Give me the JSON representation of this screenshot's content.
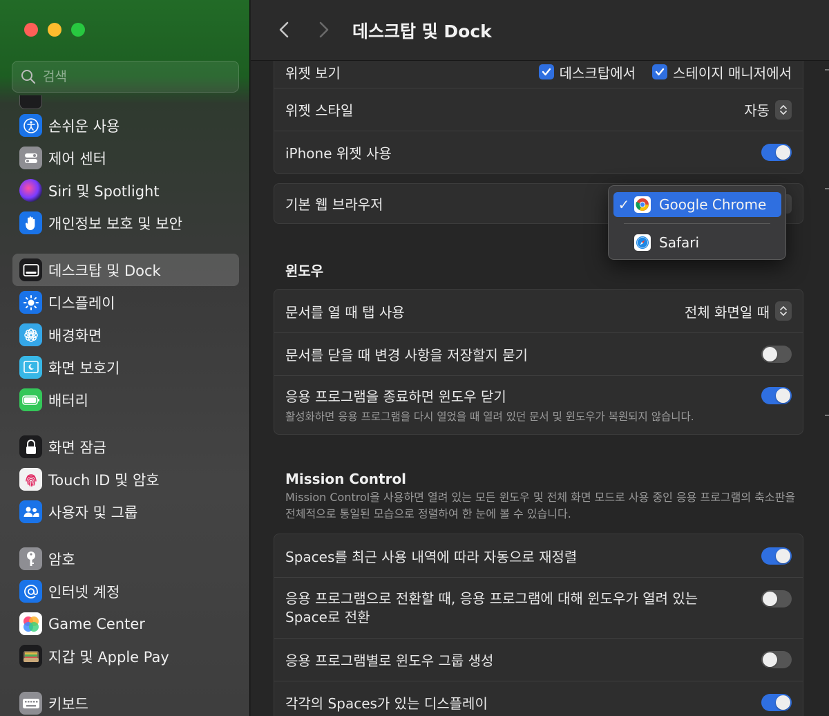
{
  "window": {
    "title": "데스크탑 및 Dock"
  },
  "sidebar": {
    "search_placeholder": "검색",
    "items": [
      {
        "label": "",
        "icon": "partial-icon",
        "color": "#1c1c1e"
      },
      {
        "label": "손쉬운 사용",
        "icon": "accessibility-icon",
        "color": "#1a73e8"
      },
      {
        "label": "제어 센터",
        "icon": "control-center-icon",
        "color": "#8e8e93"
      },
      {
        "label": "Siri 및 Spotlight",
        "icon": "siri-icon",
        "color": "#5b2bd6"
      },
      {
        "label": "개인정보 보호 및 보안",
        "icon": "hand-icon",
        "color": "#1a73e8"
      },
      {
        "label": "데스크탑 및 Dock",
        "icon": "dock-icon",
        "color": "#1c1c1e",
        "active": true
      },
      {
        "label": "디스플레이",
        "icon": "sun-icon",
        "color": "#1a73e8"
      },
      {
        "label": "배경화면",
        "icon": "flower-icon",
        "color": "#35a7e8"
      },
      {
        "label": "화면 보호기",
        "icon": "screensaver-icon",
        "color": "#38b7e6"
      },
      {
        "label": "배터리",
        "icon": "battery-icon",
        "color": "#34c759"
      },
      {
        "label": "화면 잠금",
        "icon": "lock-icon",
        "color": "#1c1c1e"
      },
      {
        "label": "Touch ID 및 암호",
        "icon": "fingerprint-icon",
        "color": "#f2f2f2"
      },
      {
        "label": "사용자 및 그룹",
        "icon": "users-icon",
        "color": "#1a73e8"
      },
      {
        "label": "암호",
        "icon": "key-icon",
        "color": "#8e8e93"
      },
      {
        "label": "인터넷 계정",
        "icon": "at-icon",
        "color": "#1a73e8"
      },
      {
        "label": "Game Center",
        "icon": "game-center-icon",
        "color": "#ffffff"
      },
      {
        "label": "지갑 및 Apple Pay",
        "icon": "wallet-icon",
        "color": "#1c1c1e"
      },
      {
        "label": "키보드",
        "icon": "keyboard-icon",
        "color": "#8e8e93"
      }
    ]
  },
  "widgets": {
    "show_label": "위젯 보기",
    "on_desktop": "데스크탑에서",
    "on_stage_manager": "스테이지 매니저에서",
    "style_label": "위젯 스타일",
    "style_value": "자동",
    "iphone_label": "iPhone 위젯 사용",
    "iphone_on": true
  },
  "browser": {
    "label": "기본 웹 브라우저",
    "options": [
      "Google Chrome",
      "Safari"
    ],
    "selected": "Google Chrome"
  },
  "windows": {
    "title": "윈도우",
    "tabs_label": "문서를 열 때 탭 사용",
    "tabs_value": "전체 화면일 때",
    "ask_save_label": "문서를 닫을 때 변경 사항을 저장할지 묻기",
    "ask_save_on": false,
    "close_on_quit_label": "응용 프로그램을 종료하면 윈도우 닫기",
    "close_on_quit_desc": "활성화하면 응용 프로그램을 다시 열었을 때 열려 있던 문서 및 윈도우가 복원되지 않습니다.",
    "close_on_quit_on": true
  },
  "mission_control": {
    "title": "Mission Control",
    "desc": "Mission Control을 사용하면 열려 있는 모든 윈도우 및 전체 화면 모드로 사용 중인 응용 프로그램의 축소판을 전체적으로 통일된 모습으로 정렬하여 한 눈에 볼 수 있습니다.",
    "rearrange_label": "Spaces를 최근 사용 내역에 따라 자동으로 재정렬",
    "rearrange_on": true,
    "switch_label": "응용 프로그램으로 전환할 때, 응용 프로그램에 대해 윈도우가 열려 있는 Space로 전환",
    "switch_on": false,
    "group_label": "응용 프로그램별로 윈도우 그룹 생성",
    "group_on": false,
    "separate_label": "각각의 Spaces가 있는 디스플레이",
    "separate_on": true
  },
  "colors": {
    "accent": "#2f6fe0",
    "sidebar_green": "#226b27"
  }
}
